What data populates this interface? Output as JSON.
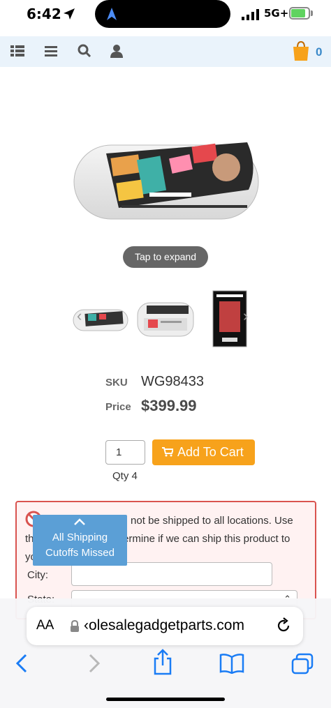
{
  "status_bar": {
    "time": "6:42",
    "network": "5G+",
    "battery_level": 0.75,
    "icons": [
      "location-arrow-icon",
      "navigation-icon",
      "signal-icon",
      "battery-charging-icon"
    ]
  },
  "site_nav": {
    "icons": [
      "list-icon",
      "menu-icon",
      "search-icon",
      "user-icon",
      "shopping-bag-icon"
    ],
    "cart_count": "0"
  },
  "product": {
    "tap_to_expand": "Tap to expand",
    "sku_label": "SKU",
    "sku": "WG98433",
    "price_label": "Price",
    "price": "$399.99",
    "quantity_value": "1",
    "add_to_cart": "Add To Cart",
    "qty_note": "Qty 4"
  },
  "shipping": {
    "line1": "This product can not be shipped to all locations. Use",
    "line2": "the form below to determine if we can ship this product to",
    "line3": "you.",
    "city_label": "City:",
    "state_label": "State:",
    "cutoff_line1": "All Shipping",
    "cutoff_line2": "Cutoffs Missed"
  },
  "browser": {
    "aa": "AA",
    "url": "‹olesalegadgetparts.com",
    "toolbar_icons": [
      "back-icon",
      "forward-icon",
      "share-icon",
      "bookmarks-icon",
      "tabs-icon"
    ]
  },
  "colors": {
    "accent": "#f7a21b",
    "link_blue": "#3a89c9",
    "alert_border": "#d9534f",
    "ios_blue": "#1a7cf5"
  }
}
